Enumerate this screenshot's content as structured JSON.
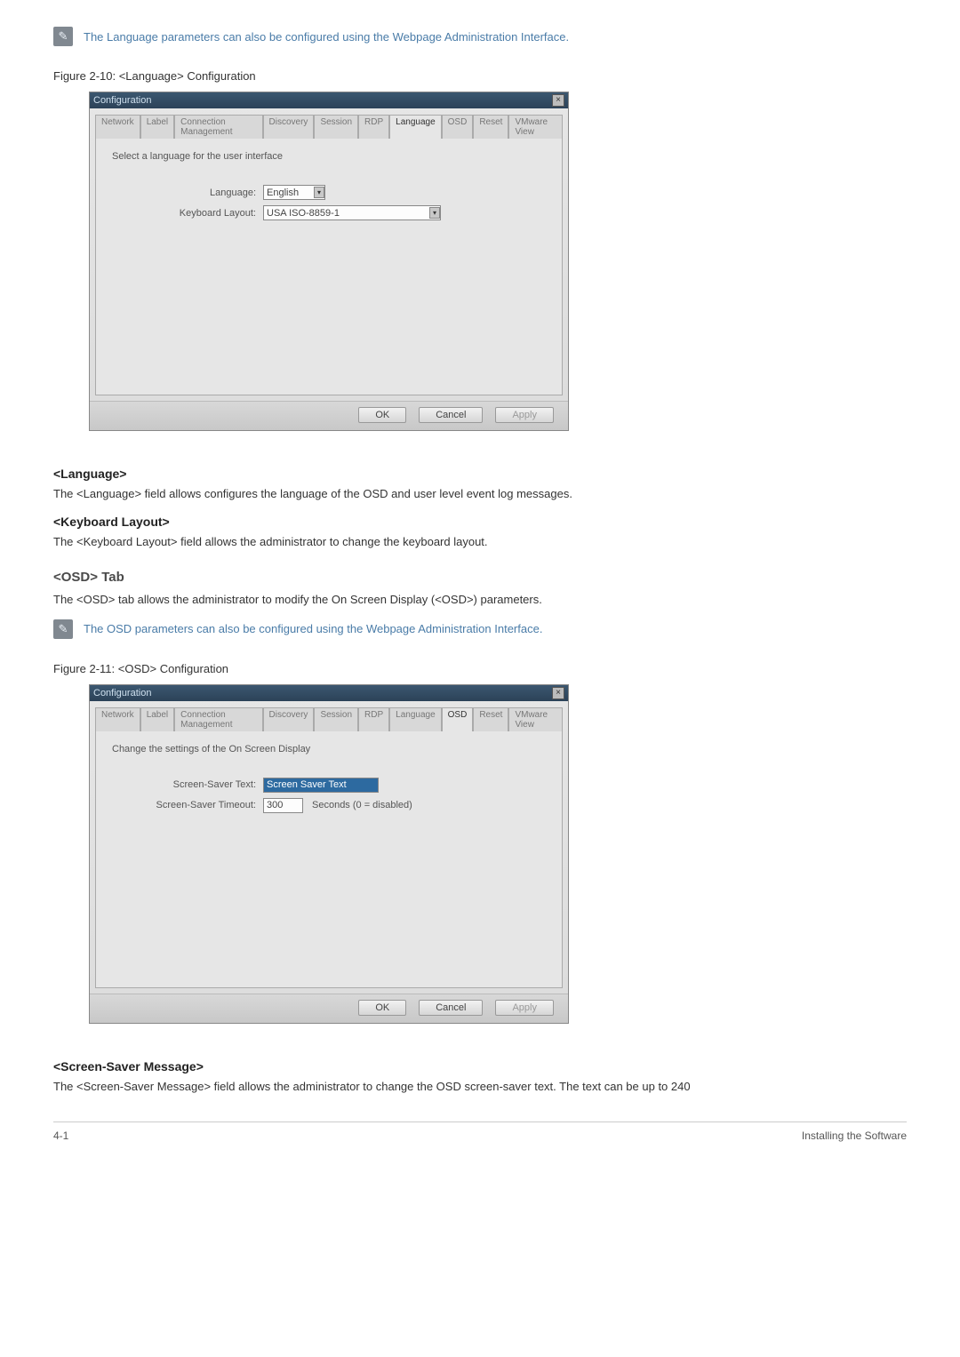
{
  "note1": "The Language parameters can also be configured using the Webpage Administration Interface.",
  "fig1_caption": "Figure 2-10: <Language> Configuration",
  "dlg1": {
    "title": "Configuration",
    "tabs": [
      "Network",
      "Label",
      "Connection Management",
      "Discovery",
      "Session",
      "RDP",
      "Language",
      "OSD",
      "Reset",
      "VMware View"
    ],
    "active_tab_index": 6,
    "intro": "Select a language for the user interface",
    "lang_label": "Language:",
    "lang_value": "English",
    "kbd_label": "Keyboard Layout:",
    "kbd_value": "USA ISO-8859-1",
    "ok": "OK",
    "cancel": "Cancel",
    "apply": "Apply"
  },
  "sec_lang_h": "<Language>",
  "sec_lang_p": "The <Language> field allows configures the language of the OSD and user level event log messages.",
  "sec_kbd_h": "<Keyboard Layout>",
  "sec_kbd_p": "The <Keyboard Layout> field allows the administrator to change the keyboard layout.",
  "sec_osd_h": "<OSD> Tab",
  "sec_osd_p": "The <OSD> tab allows the administrator to modify the On Screen Display (<OSD>) parameters.",
  "note2": "The OSD parameters can also be configured using the Webpage Administration Interface.",
  "fig2_caption": "Figure 2-11: <OSD> Configuration",
  "dlg2": {
    "title": "Configuration",
    "tabs": [
      "Network",
      "Label",
      "Connection Management",
      "Discovery",
      "Session",
      "RDP",
      "Language",
      "OSD",
      "Reset",
      "VMware View"
    ],
    "active_tab_index": 7,
    "intro": "Change the settings of the On Screen Display",
    "sst_label": "Screen-Saver Text:",
    "sst_value": "Screen Saver Text",
    "sstime_label": "Screen-Saver Timeout:",
    "sstime_value": "300",
    "sstime_note": "Seconds (0 = disabled)",
    "ok": "OK",
    "cancel": "Cancel",
    "apply": "Apply"
  },
  "sec_ssm_h": "<Screen-Saver Message>",
  "sec_ssm_p": "The <Screen-Saver Message> field allows the administrator to change the OSD screen-saver text. The text can be up to 240",
  "footer_left": "4-1",
  "footer_right": "Installing the Software"
}
